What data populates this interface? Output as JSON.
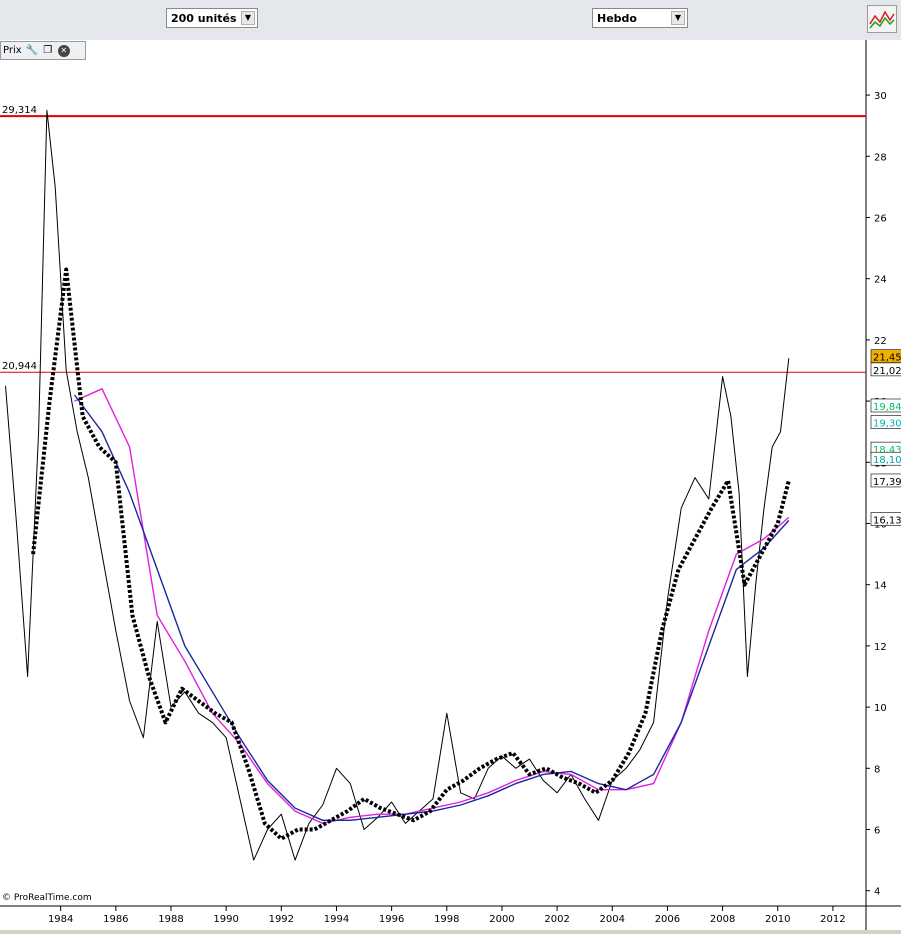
{
  "toolbar": {
    "units_select": "200 unités",
    "period_select": "Hebdo"
  },
  "panel": {
    "title": "Prix"
  },
  "credit": "© ProRealTime.com",
  "colors": {
    "hline": "#e00000",
    "price": "#000000",
    "magenta": "#e020e0",
    "navy": "#1a2a9a",
    "dotted": "#000000"
  },
  "chart_data": {
    "type": "line",
    "x_ticks": [
      "1984",
      "1986",
      "1988",
      "1990",
      "1992",
      "1994",
      "1996",
      "1998",
      "2000",
      "2002",
      "2004",
      "2006",
      "2008",
      "2010",
      "2012"
    ],
    "y_ticks": [
      "4",
      "6",
      "8",
      "10",
      "12",
      "14",
      "16",
      "18",
      "20",
      "22",
      "24",
      "26",
      "28",
      "30"
    ],
    "ylim": [
      3.5,
      31.8
    ],
    "xlim": [
      1981.8,
      2013.2
    ],
    "horizontal_lines": [
      {
        "label": "29,314",
        "value": 29.314
      },
      {
        "label": "20,944",
        "value": 20.944
      }
    ],
    "value_badges": [
      {
        "label": "21,45",
        "value": 21.45,
        "bg": "#f0b000",
        "fg": "#000"
      },
      {
        "label": "21,02",
        "value": 21.02,
        "bg": "#ffffff",
        "fg": "#000"
      },
      {
        "label": "19,84",
        "value": 19.84,
        "bg": "#ffffff",
        "fg": "#00c060"
      },
      {
        "label": "19,30",
        "value": 19.3,
        "bg": "#ffffff",
        "fg": "#00b8b8"
      },
      {
        "label": "18,43",
        "value": 18.43,
        "bg": "#ffffff",
        "fg": "#00c060"
      },
      {
        "label": "18,10",
        "value": 18.1,
        "bg": "#ffffff",
        "fg": "#00a0a0"
      },
      {
        "label": "17,39",
        "value": 17.39,
        "bg": "#ffffff",
        "fg": "#000"
      },
      {
        "label": "16,13",
        "value": 16.13,
        "bg": "#ffffff",
        "fg": "#000"
      }
    ],
    "series": [
      {
        "x": [
          1982.0,
          1982.4,
          1982.8,
          1983.2,
          1983.5,
          1983.8,
          1984.2,
          1984.6,
          1985.0,
          1985.5,
          1986.0,
          1986.5,
          1987.0,
          1987.5,
          1988.0,
          1988.5,
          1989.0,
          1989.5,
          1990.0,
          1990.5,
          1991.0,
          1991.5,
          1992.0,
          1992.5,
          1993.0,
          1993.5,
          1994.0,
          1994.5,
          1995.0,
          1995.5,
          1996.0,
          1996.5,
          1997.0,
          1997.5,
          1998.0,
          1998.5,
          1999.0,
          1999.5,
          2000.0,
          2000.5,
          2001.0,
          2001.5,
          2002.0,
          2002.5,
          2003.0,
          2003.5,
          2004.0,
          2004.5,
          2005.0,
          2005.5,
          2006.0,
          2006.5,
          2007.0,
          2007.5,
          2008.0,
          2008.3,
          2008.6,
          2008.9,
          2009.2,
          2009.5,
          2009.8,
          2010.1,
          2010.4
        ],
        "y": [
          20.5,
          16.0,
          11.0,
          19.0,
          29.5,
          27.0,
          21.0,
          19.0,
          17.5,
          15.0,
          12.5,
          10.2,
          9.0,
          12.8,
          10.0,
          10.5,
          9.8,
          9.5,
          9.0,
          7.0,
          5.0,
          6.0,
          6.5,
          5.0,
          6.2,
          6.8,
          8.0,
          7.5,
          6.0,
          6.4,
          6.9,
          6.2,
          6.6,
          7.0,
          9.8,
          7.2,
          7.0,
          8.0,
          8.4,
          8.0,
          8.3,
          7.6,
          7.2,
          7.8,
          7.0,
          6.3,
          7.6,
          8.0,
          8.6,
          9.5,
          13.5,
          16.5,
          17.5,
          16.8,
          20.8,
          19.5,
          17.0,
          11.0,
          14.0,
          16.5,
          18.5,
          19.0,
          21.4
        ]
      },
      {
        "x": [
          1984.5,
          1985.5,
          1986.5,
          1987.5,
          1988.5,
          1989.5,
          1990.5,
          1991.5,
          1992.5,
          1993.5,
          1994.5,
          1995.5,
          1996.5,
          1997.5,
          1998.5,
          1999.5,
          2000.5,
          2001.5,
          2002.5,
          2003.5,
          2004.5,
          2005.5,
          2006.5,
          2007.5,
          2008.5,
          2009.5,
          2010.4
        ],
        "y": [
          20.0,
          20.4,
          18.5,
          13.0,
          11.5,
          9.8,
          8.8,
          7.5,
          6.6,
          6.2,
          6.4,
          6.5,
          6.5,
          6.7,
          6.9,
          7.2,
          7.6,
          7.9,
          7.8,
          7.3,
          7.3,
          7.5,
          9.5,
          12.5,
          15.0,
          15.5,
          16.2
        ]
      },
      {
        "x": [
          1984.5,
          1985.5,
          1986.5,
          1987.5,
          1988.5,
          1989.5,
          1990.5,
          1991.5,
          1992.5,
          1993.5,
          1994.5,
          1995.5,
          1996.5,
          1997.5,
          1998.5,
          1999.5,
          2000.5,
          2001.5,
          2002.5,
          2003.5,
          2004.5,
          2005.5,
          2006.5,
          2007.5,
          2008.5,
          2009.5,
          2010.4
        ],
        "y": [
          20.2,
          19.0,
          17.0,
          14.5,
          12.0,
          10.5,
          9.0,
          7.6,
          6.7,
          6.3,
          6.3,
          6.4,
          6.5,
          6.6,
          6.8,
          7.1,
          7.5,
          7.8,
          7.9,
          7.5,
          7.3,
          7.8,
          9.5,
          12.0,
          14.5,
          15.2,
          16.1
        ]
      },
      {
        "x": [
          1983.0,
          1983.6,
          1984.2,
          1984.8,
          1985.4,
          1986.0,
          1986.6,
          1987.2,
          1987.8,
          1988.4,
          1989.0,
          1989.6,
          1990.2,
          1990.8,
          1991.4,
          1992.0,
          1992.6,
          1993.2,
          1993.8,
          1994.4,
          1995.0,
          1995.6,
          1996.2,
          1996.8,
          1997.4,
          1998.0,
          1998.6,
          1999.2,
          1999.8,
          2000.4,
          2001.0,
          2001.6,
          2002.2,
          2002.8,
          2003.4,
          2004.0,
          2004.6,
          2005.2,
          2005.8,
          2006.4,
          2007.0,
          2007.6,
          2008.2,
          2008.8,
          2009.4,
          2010.0,
          2010.4
        ],
        "y": [
          15.0,
          20.0,
          24.3,
          19.5,
          18.5,
          18.0,
          13.0,
          11.0,
          9.5,
          10.6,
          10.2,
          9.8,
          9.5,
          8.0,
          6.2,
          5.7,
          6.0,
          6.0,
          6.3,
          6.6,
          7.0,
          6.7,
          6.5,
          6.3,
          6.6,
          7.3,
          7.6,
          8.0,
          8.3,
          8.5,
          7.8,
          8.0,
          7.7,
          7.5,
          7.2,
          7.6,
          8.5,
          9.8,
          12.5,
          14.5,
          15.5,
          16.5,
          17.4,
          14.0,
          15.0,
          16.0,
          17.4
        ]
      }
    ]
  }
}
